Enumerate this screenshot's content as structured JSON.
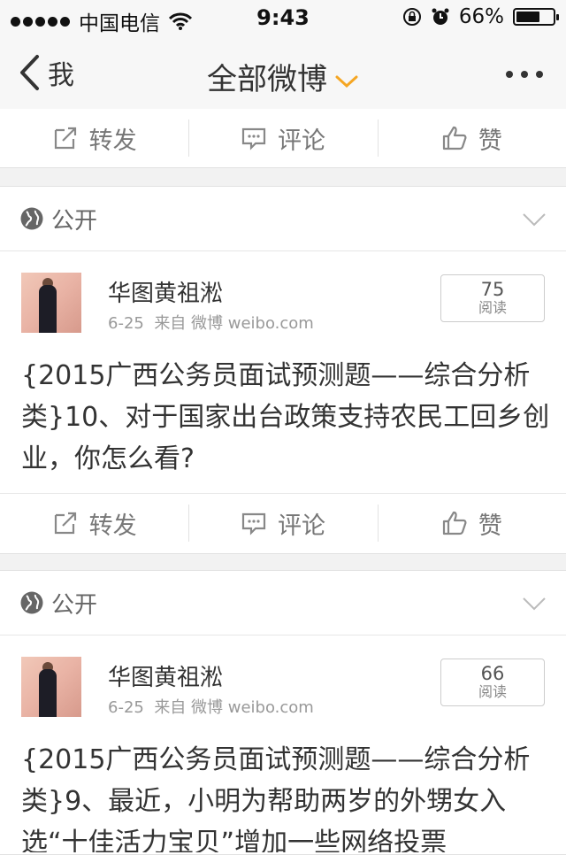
{
  "status": {
    "carrier": "中国电信",
    "time": "9:43",
    "battery": "66%",
    "battery_level": 0.66
  },
  "nav": {
    "back_label": "我",
    "title": "全部微博"
  },
  "actions": {
    "repost": "转发",
    "comment": "评论",
    "like": "赞"
  },
  "posts": [
    {
      "visibility": "公开",
      "author": "华图黄祖淞",
      "date": "6-25",
      "source": "来自 微博 weibo.com",
      "reads": "75",
      "reads_label": "阅读",
      "text": "{2015广西公务员面试预测题——综合分析类}10、对于国家出台政策支持农民工回乡创业，你怎么看?"
    },
    {
      "visibility": "公开",
      "author": "华图黄祖淞",
      "date": "6-25",
      "source": "来自 微博 weibo.com",
      "reads": "66",
      "reads_label": "阅读",
      "text": "{2015广西公务员面试预测题——综合分析类}9、最近，小明为帮助两岁的外甥女入选“十佳活力宝贝”增加一些网络投票"
    }
  ],
  "colors": {
    "accent": "#f5a623",
    "background": "#f2f2f2"
  },
  "icons": [
    "signal-dots",
    "wifi-icon",
    "lock-rotation-icon",
    "alarm-icon",
    "battery-icon",
    "back-chevron-icon",
    "dropdown-chevron-icon",
    "more-icon",
    "repost-icon",
    "comment-icon",
    "like-icon",
    "globe-icon",
    "caret-down-icon"
  ]
}
